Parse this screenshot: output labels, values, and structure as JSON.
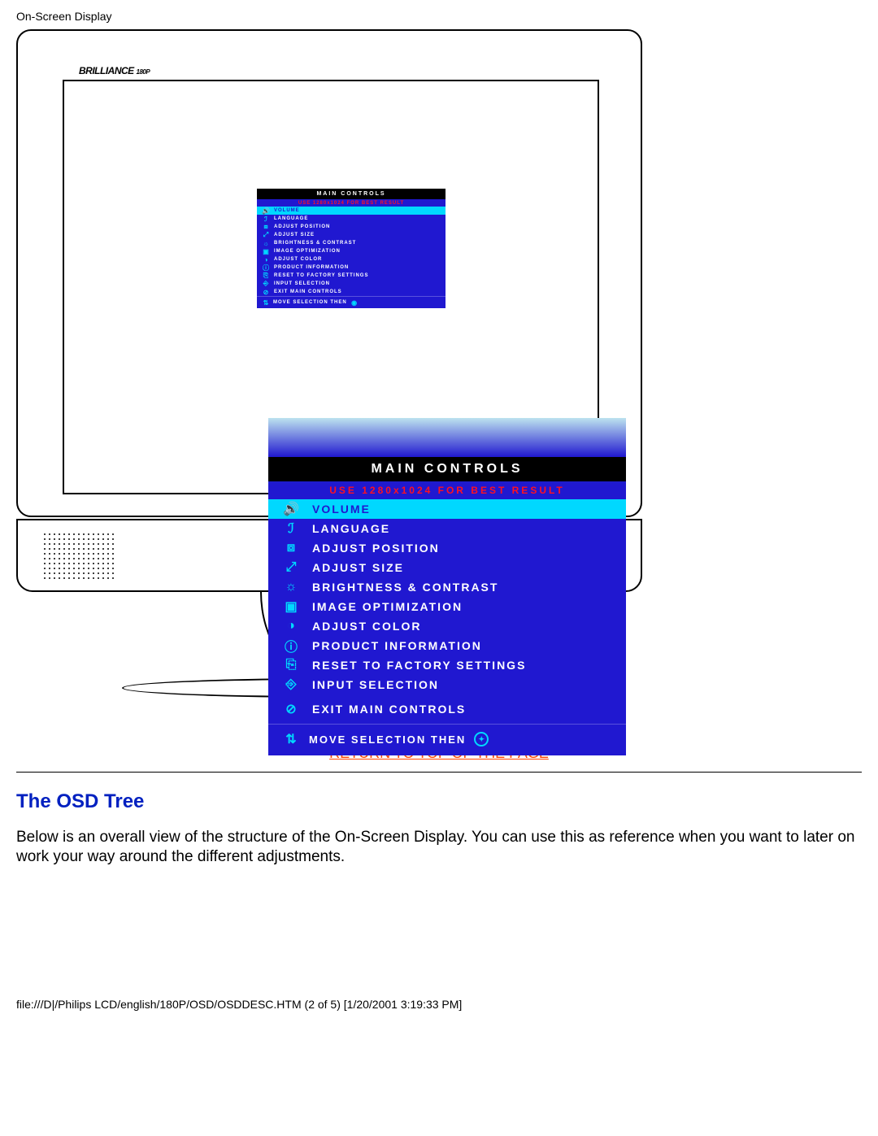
{
  "header": {
    "title": "On-Screen Display"
  },
  "monitor": {
    "brand": "BRILLIANCE",
    "brand_suffix": "180P"
  },
  "osd": {
    "title": "MAIN CONTROLS",
    "hint": "USE 1280x1024 FOR BEST RESULT",
    "items": [
      {
        "icon": "volume-icon",
        "glyph": "🔊",
        "label": "VOLUME",
        "selected": true
      },
      {
        "icon": "language-icon",
        "glyph": "ℐ",
        "label": "LANGUAGE"
      },
      {
        "icon": "position-icon",
        "glyph": "⧈",
        "label": "ADJUST POSITION"
      },
      {
        "icon": "size-icon",
        "glyph": "⤢",
        "label": "ADJUST SIZE"
      },
      {
        "icon": "brightness-icon",
        "glyph": "☼",
        "label": "BRIGHTNESS & CONTRAST"
      },
      {
        "icon": "optimize-icon",
        "glyph": "▣",
        "label": "IMAGE OPTIMIZATION"
      },
      {
        "icon": "color-icon",
        "glyph": "◑",
        "label": "ADJUST COLOR"
      },
      {
        "icon": "info-icon",
        "glyph": "ⓘ",
        "label": "PRODUCT INFORMATION"
      },
      {
        "icon": "reset-icon",
        "glyph": "⎘",
        "label": "RESET TO FACTORY SETTINGS"
      },
      {
        "icon": "input-icon",
        "glyph": "⎆",
        "label": "INPUT SELECTION"
      },
      {
        "icon": "exit-icon",
        "glyph": "⊘",
        "label": "EXIT MAIN CONTROLS",
        "gap": true
      }
    ],
    "footer": {
      "move_glyph": "⇅",
      "text": "MOVE SELECTION THEN",
      "ok_glyph": "◉"
    }
  },
  "links": {
    "return_top": "RETURN TO TOP OF THE PAGE"
  },
  "section": {
    "heading": "The OSD Tree",
    "body": "Below is an overall view of the structure of the On-Screen Display. You can use this as reference when you want to later on work your way around the different adjustments."
  },
  "footer_path": "file:///D|/Philips LCD/english/180P/OSD/OSDDESC.HTM (2 of 5) [1/20/2001 3:19:33 PM]"
}
